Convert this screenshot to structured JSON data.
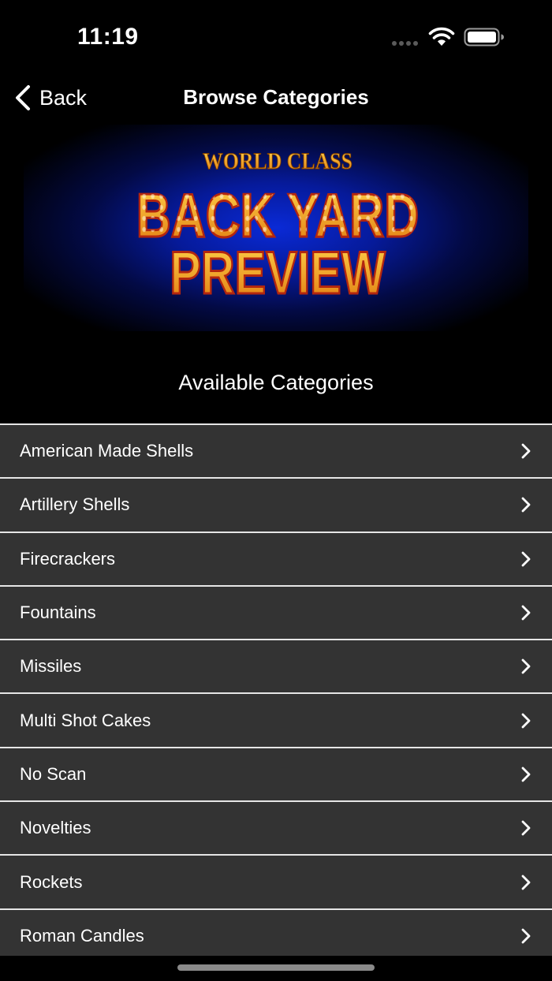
{
  "status_bar": {
    "time": "11:19",
    "icons": [
      "signal-dots-icon",
      "wifi-icon",
      "battery-icon"
    ]
  },
  "nav": {
    "back_label": "Back",
    "title": "Browse Categories"
  },
  "banner": {
    "line1": "WORLD CLASS",
    "line2": "BACK YARD",
    "line3": "PREVIEW",
    "colors": {
      "background": "#0a2ad6",
      "letters": "#f5a623",
      "bulbs": "#fff3c4",
      "outline": "#b3260f"
    }
  },
  "section_title": "Available Categories",
  "categories": [
    {
      "label": "American Made Shells"
    },
    {
      "label": "Artillery Shells"
    },
    {
      "label": "Firecrackers"
    },
    {
      "label": "Fountains"
    },
    {
      "label": "Missiles"
    },
    {
      "label": "Multi Shot Cakes"
    },
    {
      "label": "No Scan"
    },
    {
      "label": "Novelties"
    },
    {
      "label": "Rockets"
    },
    {
      "label": "Roman Candles"
    }
  ]
}
